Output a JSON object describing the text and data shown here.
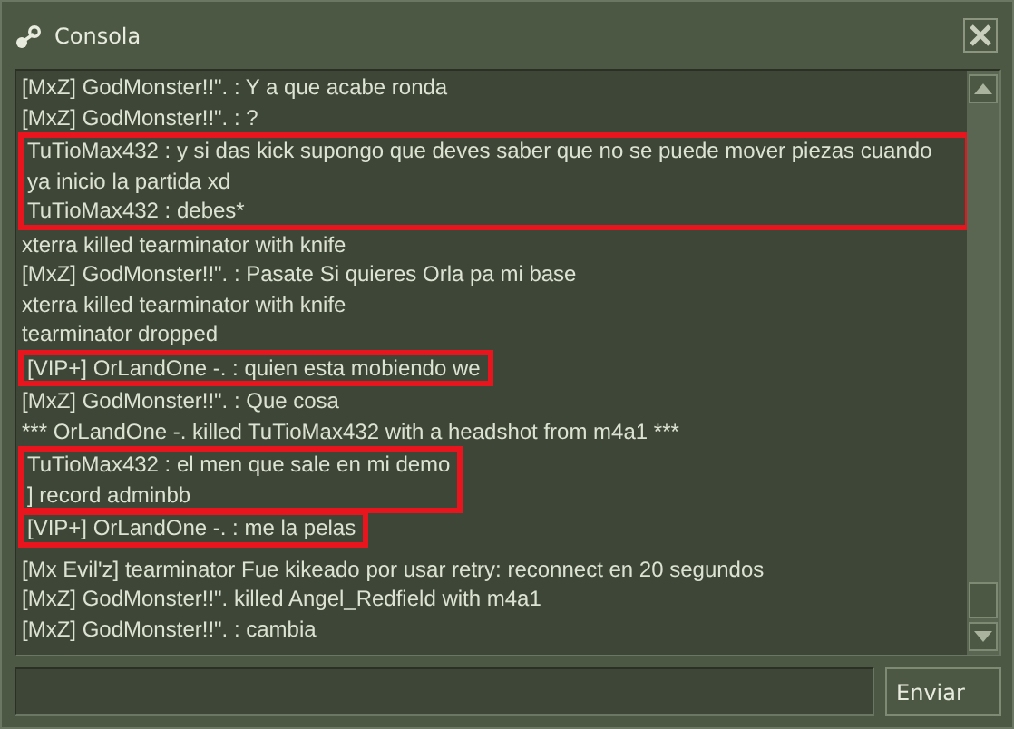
{
  "window": {
    "title": "Consola"
  },
  "log": {
    "blocks": [
      {
        "highlighted": false,
        "lines": [
          "[MxZ] GodMonster!!\". : Y a que acabe ronda",
          "[MxZ] GodMonster!!\". : ?"
        ]
      },
      {
        "highlighted": true,
        "lines": [
          "TuTioMax432 : y si das kick supongo que deves saber que no se puede mover piezas cuando ya inicio la partida xd",
          "TuTioMax432 : debes*"
        ]
      },
      {
        "highlighted": false,
        "lines": [
          "xterra killed tearminator with knife",
          "[MxZ] GodMonster!!\". : Pasate Si  quieres Orla pa mi base",
          "xterra killed tearminator with knife",
          "tearminator dropped"
        ]
      },
      {
        "highlighted": true,
        "lines": [
          "[VIP+] OrLandOne -. : quien esta mobiendo we"
        ]
      },
      {
        "highlighted": false,
        "lines": [
          "[MxZ] GodMonster!!\". : Que cosa",
          "*** OrLandOne -. killed TuTioMax432 with a headshot from m4a1 ***"
        ]
      },
      {
        "highlighted": true,
        "lines": [
          "TuTioMax432 : el men que sale en mi demo",
          "] record adminbb"
        ]
      },
      {
        "highlighted": true,
        "lines": [
          "[VIP+] OrLandOne -. : me la pelas"
        ]
      },
      {
        "highlighted": false,
        "lines": [
          "[Mx Evil'z] tearminator Fue kikeado por usar retry: reconnect en 20 segundos",
          "[MxZ] GodMonster!!\". killed Angel_Redfield with m4a1",
          "[MxZ] GodMonster!!\". : cambia"
        ]
      }
    ]
  },
  "send_button": {
    "label": "Enviar"
  }
}
